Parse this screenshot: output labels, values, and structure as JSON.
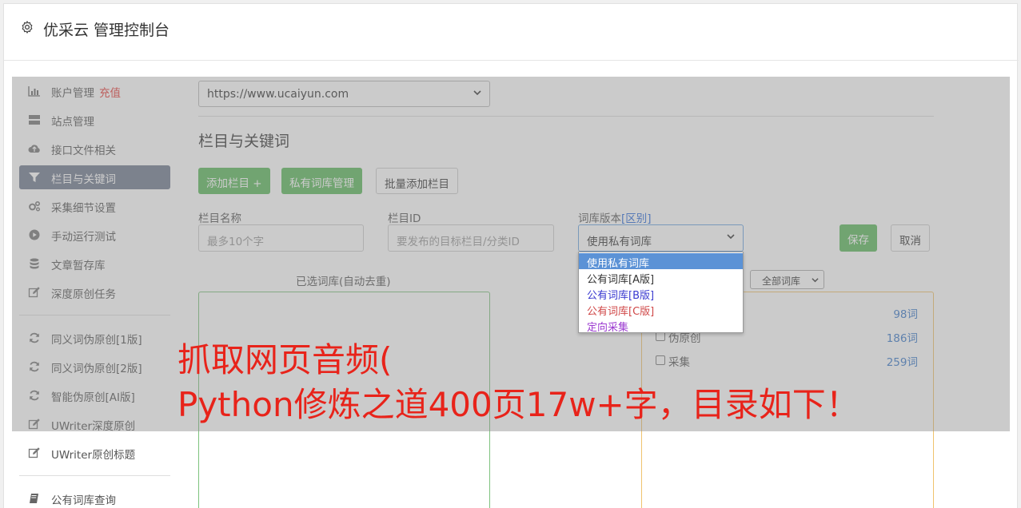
{
  "header": {
    "title": "优采云 管理控制台"
  },
  "sidebar": {
    "items": [
      {
        "label": "账户管理",
        "extra": "充值",
        "icon": "bar-chart-icon"
      },
      {
        "label": "站点管理",
        "icon": "server-icon"
      },
      {
        "label": "接口文件相关",
        "icon": "cloud-upload-icon"
      },
      {
        "label": "栏目与关键词",
        "icon": "filter-icon",
        "active": true
      },
      {
        "label": "采集细节设置",
        "icon": "cogs-icon"
      },
      {
        "label": "手动运行测试",
        "icon": "play-circle-icon"
      },
      {
        "label": "文章暂存库",
        "icon": "database-icon"
      },
      {
        "label": "深度原创任务",
        "icon": "edit-icon"
      },
      {
        "label": "同义词伪原创[1版]",
        "icon": "refresh-icon"
      },
      {
        "label": "同义词伪原创[2版]",
        "icon": "refresh-icon"
      },
      {
        "label": "智能伪原创[AI版]",
        "icon": "refresh-icon"
      },
      {
        "label": "UWriter深度原创",
        "icon": "edit-icon"
      },
      {
        "label": "UWriter原创标题",
        "icon": "edit-icon"
      },
      {
        "label": "公有词库查询",
        "icon": "book-icon"
      }
    ]
  },
  "site_select": {
    "value": "https://www.ucaiyun.com"
  },
  "section": {
    "title": "栏目与关键词"
  },
  "buttons": {
    "add_column": "添加栏目 +",
    "private_lib": "私有词库管理",
    "batch_add": "批量添加栏目",
    "save": "保存",
    "cancel": "取消"
  },
  "form": {
    "name_label": "栏目名称",
    "name_placeholder": "最多10个字",
    "id_label": "栏目ID",
    "id_placeholder": "要发布的目标栏目/分类ID",
    "lib_label": "词库版本",
    "lib_label_link": "[区别]",
    "lib_value": "使用私有词库"
  },
  "dropdown": {
    "options": [
      {
        "label": "使用私有词库",
        "color": "#ffffff",
        "selected": true
      },
      {
        "label": "公有词库[A版]",
        "color": "#333333"
      },
      {
        "label": "公有词库[B版]",
        "color": "#3a3ad0"
      },
      {
        "label": "公有词库[C版]",
        "color": "#d04848"
      },
      {
        "label": "定向采集",
        "color": "#9b3ad0"
      }
    ]
  },
  "selected_libs": {
    "title": "已选词库(自动去重)"
  },
  "all_libs": {
    "select_value": "全部词库",
    "rows": [
      {
        "name": "",
        "count": "98词"
      },
      {
        "name": "伪原创",
        "count": "186词"
      },
      {
        "name": "采集",
        "count": "259词"
      }
    ]
  },
  "overlay": {
    "line1": "抓取网页音频(",
    "line2": "Python修炼之道400页17w+字，目录如下！"
  },
  "colors": {
    "accent_green": "#5cb85c",
    "active_nav": "#707b8f",
    "recharge_red": "#e53935",
    "overlay_text": "#e8231a"
  }
}
